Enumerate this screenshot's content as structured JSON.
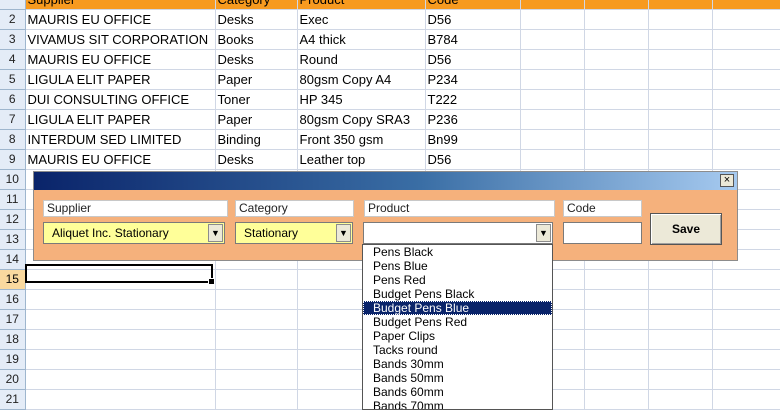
{
  "sheet": {
    "header": {
      "row_num": "",
      "supplier": "Supplier",
      "category": "Category",
      "product": "Product",
      "code": "Code"
    },
    "rows": [
      {
        "num": "2",
        "supplier": "MAURIS EU OFFICE",
        "category": "Desks",
        "product": "Exec",
        "code": "D56"
      },
      {
        "num": "3",
        "supplier": "VIVAMUS SIT CORPORATION",
        "category": "Books",
        "product": "A4 thick",
        "code": "B784"
      },
      {
        "num": "4",
        "supplier": "MAURIS EU OFFICE",
        "category": "Desks",
        "product": "Round",
        "code": "D56"
      },
      {
        "num": "5",
        "supplier": "LIGULA ELIT PAPER",
        "category": "Paper",
        "product": "80gsm Copy A4",
        "code": "P234"
      },
      {
        "num": "6",
        "supplier": "DUI CONSULTING OFFICE",
        "category": "Toner",
        "product": "HP 345",
        "code": "T222"
      },
      {
        "num": "7",
        "supplier": "LIGULA ELIT PAPER",
        "category": "Paper",
        "product": "80gsm Copy SRA3",
        "code": "P236"
      },
      {
        "num": "8",
        "supplier": "INTERDUM SED LIMITED",
        "category": "Binding",
        "product": "Front 350 gsm",
        "code": "Bn99"
      },
      {
        "num": "9",
        "supplier": "MAURIS EU OFFICE",
        "category": "Desks",
        "product": "Leather top",
        "code": "D56"
      },
      {
        "num": "10",
        "supplier": "",
        "category": "",
        "product": "",
        "code": ""
      },
      {
        "num": "11",
        "supplier": "",
        "category": "",
        "product": "",
        "code": ""
      },
      {
        "num": "12",
        "supplier": "",
        "category": "",
        "product": "",
        "code": ""
      },
      {
        "num": "13",
        "supplier": "",
        "category": "",
        "product": "",
        "code": ""
      },
      {
        "num": "14",
        "supplier": "",
        "category": "",
        "product": "",
        "code": ""
      },
      {
        "num": "15",
        "supplier": "",
        "category": "",
        "product": "",
        "code": ""
      },
      {
        "num": "16",
        "supplier": "",
        "category": "",
        "product": "",
        "code": ""
      },
      {
        "num": "17",
        "supplier": "",
        "category": "",
        "product": "",
        "code": ""
      },
      {
        "num": "18",
        "supplier": "",
        "category": "",
        "product": "",
        "code": ""
      },
      {
        "num": "19",
        "supplier": "",
        "category": "",
        "product": "",
        "code": ""
      },
      {
        "num": "20",
        "supplier": "",
        "category": "",
        "product": "",
        "code": ""
      },
      {
        "num": "21",
        "supplier": "",
        "category": "",
        "product": "",
        "code": ""
      }
    ],
    "selected_row": "15"
  },
  "form": {
    "close_label": "×",
    "supplier_label": "Supplier",
    "supplier_value": "Aliquet Inc. Stationary",
    "category_label": "Category",
    "category_value": "Stationary",
    "product_label": "Product",
    "product_value": "",
    "code_label": "Code",
    "code_value": "",
    "save_label": "Save",
    "arrow_glyph": "▼",
    "combo_color": "#ffff99"
  },
  "dropdown": {
    "options": [
      "Pens Black",
      "Pens Blue",
      "Pens Red",
      "Budget Pens Black",
      "Budget Pens Blue",
      "Budget Pens Red",
      "Paper Clips",
      "Tacks round",
      "Bands 30mm",
      "Bands 50mm",
      "Bands 60mm",
      "Bands 70mm"
    ],
    "selected": "Budget Pens Blue"
  },
  "colors": {
    "header_fill": "#f79a1f",
    "form_bg": "#f5b17c",
    "selection": "#0a246a"
  }
}
